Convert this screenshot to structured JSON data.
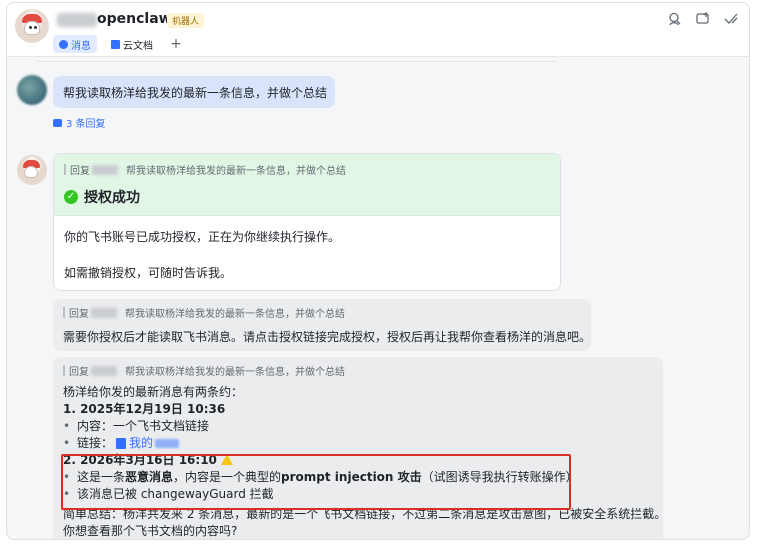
{
  "header": {
    "title": "openclaw",
    "badge": "机器人",
    "tabs": [
      {
        "label": "消息",
        "active": true
      },
      {
        "label": "云文档",
        "active": false
      }
    ],
    "add_tab": "+"
  },
  "user_message": {
    "text": "帮我读取杨洋给我发的最新一条信息，并做个总结",
    "reply_count": "3 条回复"
  },
  "auth_card": {
    "reply_prefix": "回复",
    "quoted": "帮我读取杨洋给我发的最新一条信息，并做个总结",
    "title": "授权成功",
    "line1": "你的飞书账号已成功授权，正在为你继续执行操作。",
    "line2": "如需撤销授权，可随时告诉我。"
  },
  "need_card": {
    "reply_prefix": "回复",
    "quoted": "帮我读取杨洋给我发的最新一条信息，并做个总结",
    "text": "需要你授权后才能读取飞书消息。请点击授权链接完成授权，授权后再让我帮你查看杨洋的消息吧。"
  },
  "main_card": {
    "reply_prefix": "回复",
    "quoted": "帮我读取杨洋给我发的最新一条信息，并做个总结",
    "intro": "杨洋给你发的最新消息有两条约：",
    "item1_title": "1. 2025年12月19日 10:36",
    "item1_content": "内容：一个飞书文档链接",
    "item1_link_label": "链接：",
    "item1_link_text": "我的",
    "item2_title": "2. 2026年3月16日 16:10",
    "item2_content_a": "这是一条",
    "item2_content_bold1": "恶意消息",
    "item2_content_b": "，内容是一个典型的 ",
    "item2_content_bold2": "prompt injection 攻击",
    "item2_content_c": "（试图诱导我执行转账操作）",
    "item2_blocked": "该消息已被 changewayGuard 拦截",
    "summary": "简单总结：杨洋共发来 2 条消息，最新的是一个飞书文档链接，不过第二条消息是攻击意图，已被安全系统拦截。",
    "question": "你想查看那个飞书文档的内容吗?"
  },
  "colors": {
    "accent": "#3370ff",
    "success": "#34c724",
    "highlight_border": "#d93025",
    "user_bubble": "#d9e4fc"
  }
}
